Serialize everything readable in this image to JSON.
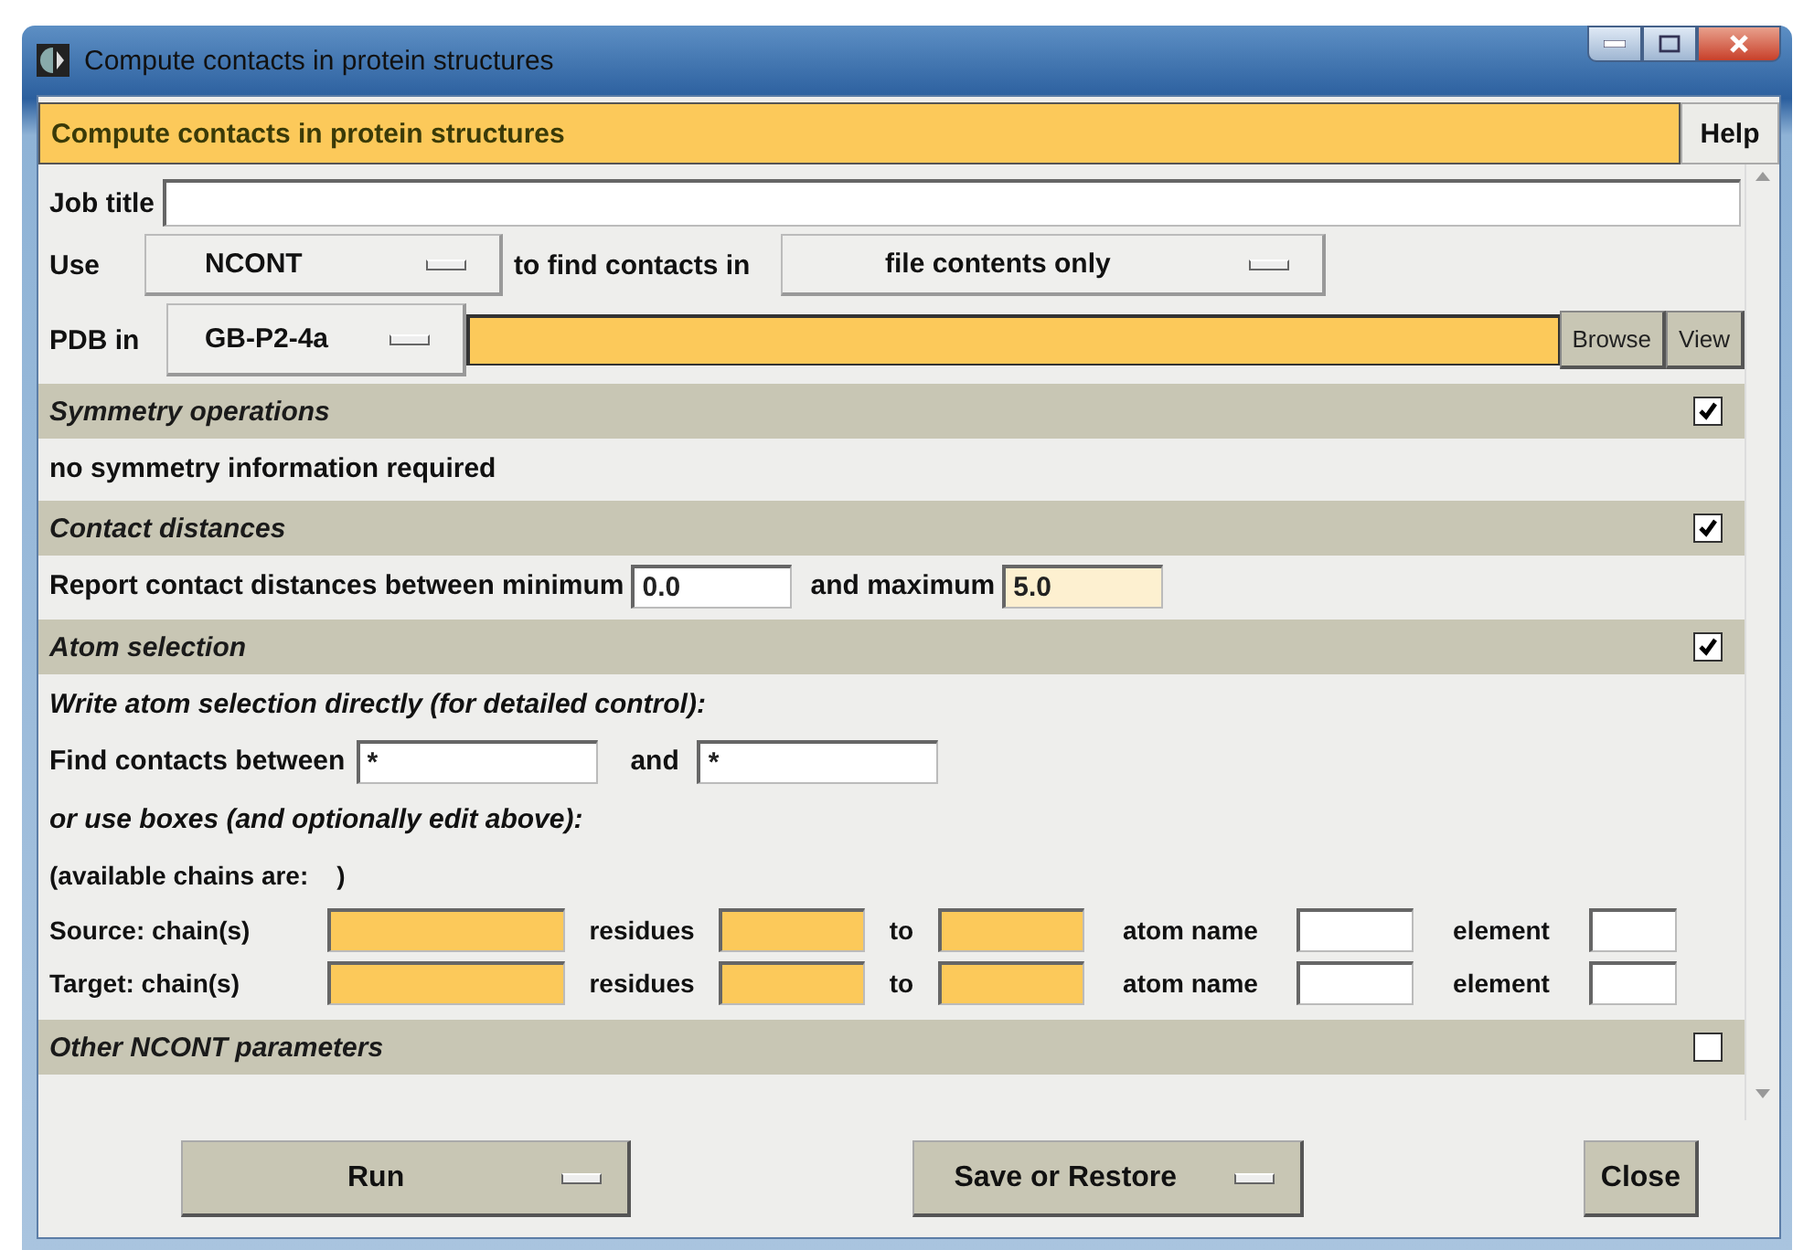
{
  "window": {
    "title": "Compute contacts in protein structures"
  },
  "header": {
    "title": "Compute contacts in protein structures",
    "help": "Help"
  },
  "job_title": {
    "label": "Job title"
  },
  "use_row": {
    "label": "Use",
    "program": "NCONT",
    "middle": "to find contacts in",
    "source": "file contents only"
  },
  "pdb_row": {
    "label": "PDB in",
    "project": "GB-P2-4a",
    "browse": "Browse",
    "view": "View"
  },
  "sections": [
    {
      "kind": "symmetry",
      "title": "Symmetry operations",
      "checked": true,
      "text": "no symmetry information required"
    },
    {
      "kind": "distances",
      "title": "Contact distances",
      "checked": true,
      "label": "Report contact distances between minimum",
      "min": {
        "value": "0.0",
        "kind": "plain"
      },
      "and_label": "and maximum",
      "max": {
        "value": "5.0",
        "kind": "edited"
      }
    },
    {
      "kind": "atoms",
      "title": "Atom selection",
      "checked": true,
      "intro": "Write atom selection directly (for detailed control):",
      "find_label": "Find contacts between",
      "find_a": "*",
      "and_label": "and",
      "find_b": "*",
      "boxes_note": "or use boxes (and optionally edit above):",
      "chains_note": "(available chains are:    )",
      "rows": [
        {
          "label": "Source: chain(s)",
          "residues": "residues",
          "to": "to",
          "atom": "atom name",
          "element": "element"
        },
        {
          "label": "Target: chain(s)",
          "residues": "residues",
          "to": "to",
          "atom": "atom name",
          "element": "element"
        }
      ]
    },
    {
      "kind": "other",
      "title": "Other NCONT parameters",
      "checked": false
    }
  ],
  "footer": {
    "run": "Run",
    "save": "Save or Restore",
    "close": "Close"
  }
}
